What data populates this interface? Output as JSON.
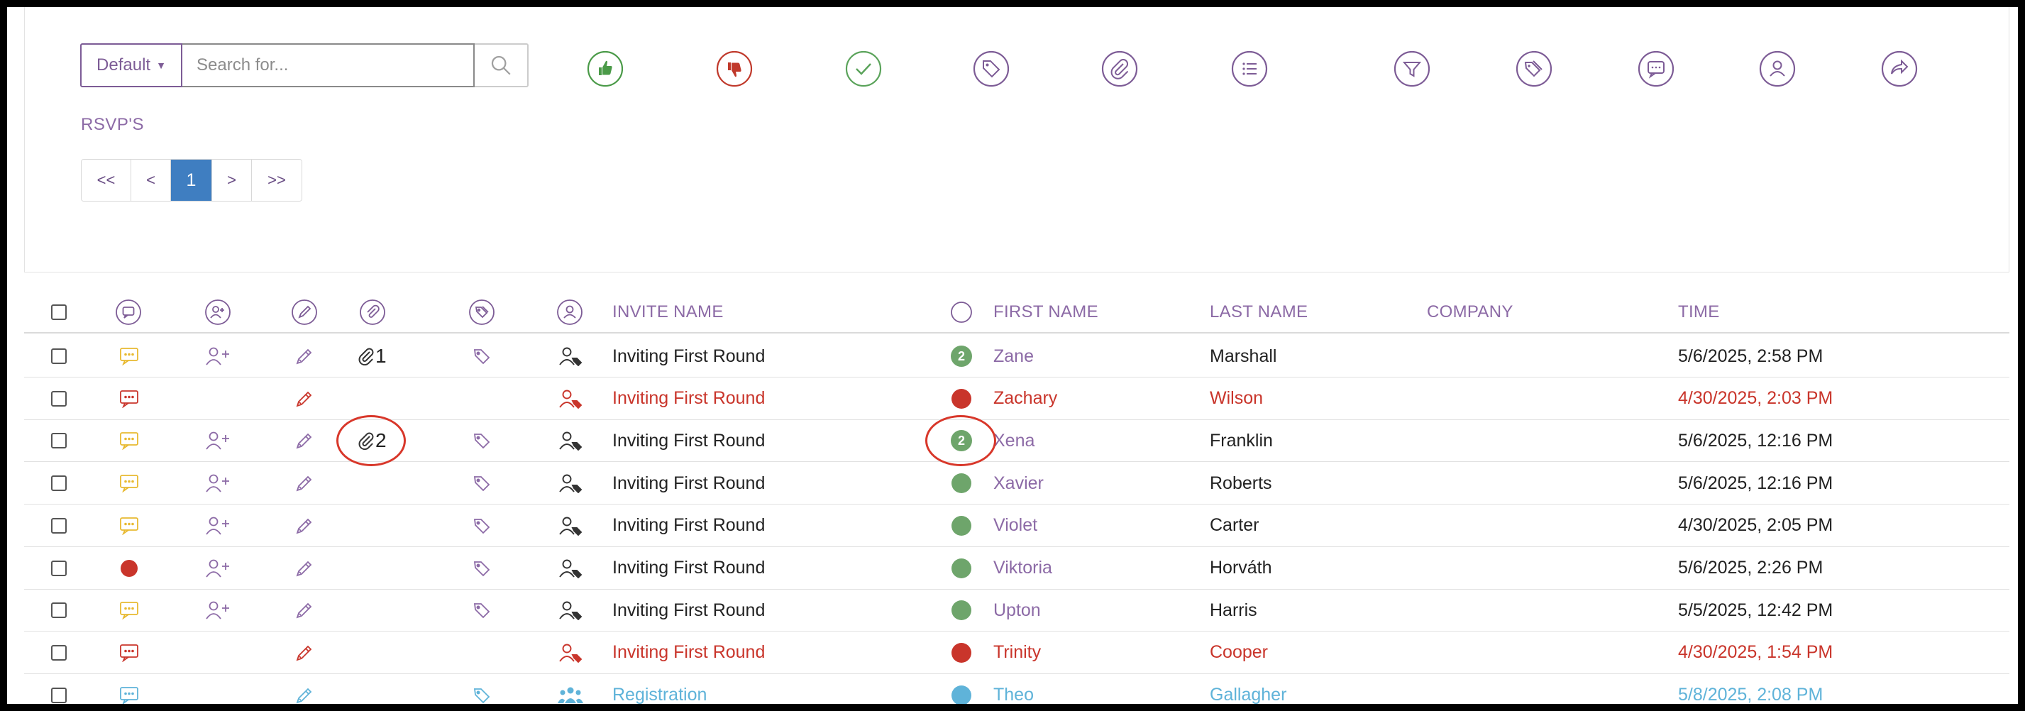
{
  "search": {
    "dropdown_label": "Default",
    "placeholder": "Search for..."
  },
  "toolbar": {
    "icons": [
      {
        "name": "thumbs-up-icon",
        "color": "#4a9a48"
      },
      {
        "name": "thumbs-down-icon",
        "color": "#c0392b"
      },
      {
        "name": "check-icon",
        "color": "#5aa35a"
      },
      {
        "name": "tag-icon",
        "color": "#7d5c96"
      },
      {
        "name": "paperclip-icon",
        "color": "#7d5c96"
      },
      {
        "name": "list-icon",
        "color": "#7d5c96"
      },
      {
        "name": "filter-icon",
        "color": "#7d5c96"
      },
      {
        "name": "tags-icon",
        "color": "#7d5c96"
      },
      {
        "name": "comment-icon",
        "color": "#7d5c96"
      },
      {
        "name": "user-icon",
        "color": "#7d5c96"
      },
      {
        "name": "share-icon",
        "color": "#7d5c96"
      }
    ]
  },
  "section_label": "RSVP'S",
  "pagination": {
    "first": "<<",
    "prev": "<",
    "current": "1",
    "next": ">",
    "last": ">>"
  },
  "table": {
    "columns": {
      "invite_name": "INVITE NAME",
      "first_name": "FIRST NAME",
      "last_name": "LAST NAME",
      "company": "COMPANY",
      "time": "TIME"
    },
    "rows": [
      {
        "comment": "yellow",
        "add_user": true,
        "attach": "1",
        "tag": true,
        "person": "user-tag",
        "status": "green",
        "status_num": "2",
        "invite": "Inviting First Round",
        "first": "Zane",
        "last": "Marshall",
        "company": "",
        "time": "5/6/2025, 2:58 PM",
        "tone": "normal"
      },
      {
        "comment": "red",
        "add_user": false,
        "attach": "",
        "tag": false,
        "person": "user-tag",
        "status": "red",
        "status_num": "",
        "invite": "Inviting First Round",
        "first": "Zachary",
        "last": "Wilson",
        "company": "",
        "time": "4/30/2025, 2:03 PM",
        "tone": "red"
      },
      {
        "comment": "yellow",
        "add_user": true,
        "attach": "2",
        "tag": true,
        "person": "user-tag",
        "status": "green",
        "status_num": "2",
        "invite": "Inviting First Round",
        "first": "Xena",
        "last": "Franklin",
        "company": "",
        "time": "5/6/2025, 12:16 PM",
        "tone": "normal",
        "highlight": true
      },
      {
        "comment": "yellow",
        "add_user": true,
        "attach": "",
        "tag": true,
        "person": "user-tag",
        "status": "green",
        "status_num": "",
        "invite": "Inviting First Round",
        "first": "Xavier",
        "last": "Roberts",
        "company": "",
        "time": "5/6/2025, 12:16 PM",
        "tone": "normal"
      },
      {
        "comment": "yellow",
        "add_user": true,
        "attach": "",
        "tag": true,
        "person": "user-tag",
        "status": "green",
        "status_num": "",
        "invite": "Inviting First Round",
        "first": "Violet",
        "last": "Carter",
        "company": "",
        "time": "4/30/2025, 2:05 PM",
        "tone": "normal"
      },
      {
        "comment": "red-dot",
        "add_user": true,
        "attach": "",
        "tag": true,
        "person": "user-tag",
        "status": "green",
        "status_num": "",
        "invite": "Inviting First Round",
        "first": "Viktoria",
        "last": "Horváth",
        "company": "",
        "time": "5/6/2025, 2:26 PM",
        "tone": "normal"
      },
      {
        "comment": "yellow",
        "add_user": true,
        "attach": "",
        "tag": true,
        "person": "user-tag",
        "status": "green",
        "status_num": "",
        "invite": "Inviting First Round",
        "first": "Upton",
        "last": "Harris",
        "company": "",
        "time": "5/5/2025, 12:42 PM",
        "tone": "normal"
      },
      {
        "comment": "red",
        "add_user": false,
        "attach": "",
        "tag": false,
        "person": "user-tag",
        "status": "red",
        "status_num": "",
        "invite": "Inviting First Round",
        "first": "Trinity",
        "last": "Cooper",
        "company": "",
        "time": "4/30/2025, 1:54 PM",
        "tone": "red"
      },
      {
        "comment": "blue",
        "add_user": false,
        "attach": "",
        "tag": true,
        "person": "users-group",
        "status": "blue",
        "status_num": "",
        "invite": "Registration",
        "first": "Theo",
        "last": "Gallagher",
        "company": "",
        "time": "5/8/2025, 2:08 PM",
        "tone": "blue"
      }
    ]
  },
  "colors": {
    "purple": "#7d5c96",
    "link_purple": "#8c6aa6",
    "red": "#c9352b",
    "green": "#6ea56b",
    "blue": "#5fb3d9",
    "yellow": "#e8b930",
    "active_page": "#3f7ec1"
  }
}
